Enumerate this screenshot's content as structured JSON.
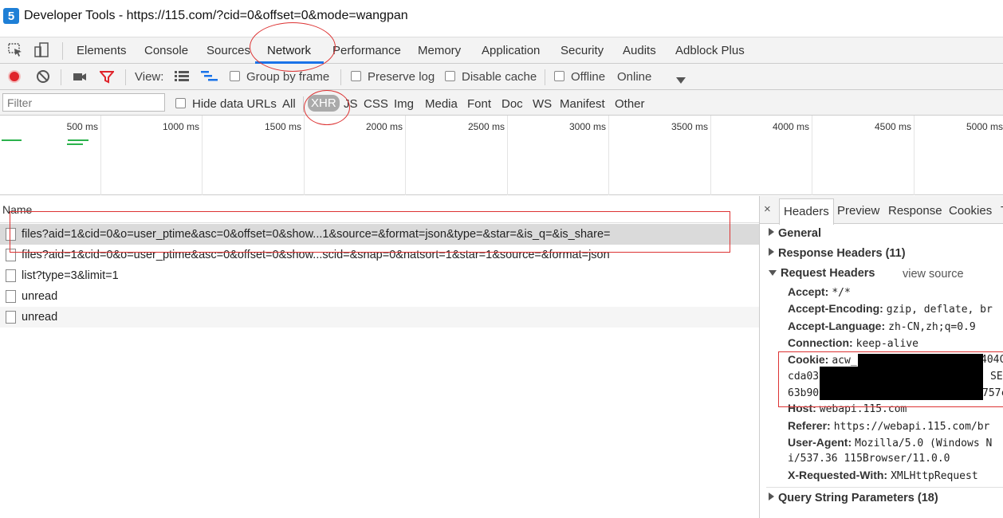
{
  "window": {
    "app_icon_glyph": "5",
    "title": "Developer Tools - https://115.com/?cid=0&offset=0&mode=wangpan"
  },
  "tabs": [
    {
      "label": "Elements"
    },
    {
      "label": "Console"
    },
    {
      "label": "Sources"
    },
    {
      "label": "Network",
      "active": true
    },
    {
      "label": "Performance"
    },
    {
      "label": "Memory"
    },
    {
      "label": "Application"
    },
    {
      "label": "Security"
    },
    {
      "label": "Audits"
    },
    {
      "label": "Adblock Plus"
    }
  ],
  "toolbar": {
    "view_label": "View:",
    "group_by_frame": "Group by frame",
    "preserve_log": "Preserve log",
    "disable_cache": "Disable cache",
    "offline": "Offline",
    "online": "Online"
  },
  "filter": {
    "placeholder": "Filter",
    "hide_data_urls": "Hide data URLs",
    "types": [
      "All",
      "XHR",
      "JS",
      "CSS",
      "Img",
      "Media",
      "Font",
      "Doc",
      "WS",
      "Manifest",
      "Other"
    ],
    "active_type": "XHR"
  },
  "timeline": {
    "labels": [
      "500 ms",
      "1000 ms",
      "1500 ms",
      "2000 ms",
      "2500 ms",
      "3000 ms",
      "3500 ms",
      "4000 ms",
      "4500 ms",
      "5000 ms"
    ]
  },
  "requests": {
    "column_name": "Name",
    "rows": [
      {
        "name": "files?aid=1&cid=0&o=user_ptime&asc=0&offset=0&show...1&source=&format=json&type=&star=&is_q=&is_share="
      },
      {
        "name": "files?aid=1&cid=0&o=user_ptime&asc=0&offset=0&show...scid=&snap=0&natsort=1&star=1&source=&format=json"
      },
      {
        "name": "list?type=3&limit=1"
      },
      {
        "name": "unread"
      },
      {
        "name": "unread"
      }
    ]
  },
  "details": {
    "close": "×",
    "tabs": [
      "Headers",
      "Preview",
      "Response",
      "Cookies",
      "T"
    ],
    "general": "General",
    "response_headers": "Response Headers (11)",
    "request_headers": "Request Headers",
    "view_source": "view source",
    "headers": [
      {
        "key": "Accept:",
        "value": "*/*"
      },
      {
        "key": "Accept-Encoding:",
        "value": "gzip, deflate, br"
      },
      {
        "key": "Accept-Language:",
        "value": "zh-CN,zh;q=0.9"
      },
      {
        "key": "Connection:",
        "value": "keep-alive"
      },
      {
        "key": "Cookie:",
        "value": "acw_"
      }
    ],
    "cookie_fragments": {
      "line1_tail": "404C",
      "line2_head": "cda03",
      "line2_tail": "SE",
      "line3_head": "63b90",
      "line3_tail": "757c"
    },
    "headers2": [
      {
        "key": "Host:",
        "value": "webapi.115.com"
      },
      {
        "key": "Referer:",
        "value": "https://webapi.115.com/br"
      },
      {
        "key": "User-Agent:",
        "value": "Mozilla/5.0 (Windows N"
      }
    ],
    "user_agent_cont": "i/537.36 115Browser/11.0.0",
    "headers3": [
      {
        "key": "X-Requested-With:",
        "value": "XMLHttpRequest"
      }
    ],
    "query_params": "Query String Parameters (18)"
  }
}
